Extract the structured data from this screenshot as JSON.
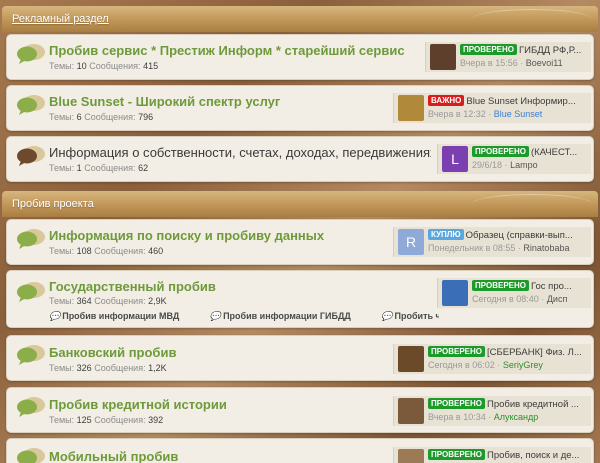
{
  "sections": [
    {
      "title": "Рекламный раздел"
    },
    {
      "title": "Пробив проекта"
    }
  ],
  "stats_labels": {
    "threads": "Темы:",
    "messages": "Сообщения:"
  },
  "nodes": [
    {
      "title": "Пробив сервис * Престиж Информ * старейший сервис ...",
      "threads": "10",
      "messages": "415",
      "last": {
        "badge": "ПРОВЕРЕНО",
        "badge_color": "#1c9b2b",
        "title": "ГИБДД РФ,Р...",
        "time": "Вчера в 15:56",
        "sep": "·",
        "user": "Boevoi11",
        "avatar_color": "#5e3f2b"
      }
    },
    {
      "title": "Blue Sunset - Широкий спектр услуг",
      "threads": "6",
      "messages": "796",
      "last": {
        "badge": "ВАЖНО",
        "badge_color": "#d81c1c",
        "title": "Blue Sunset Информир...",
        "time": "Вчера в 12:32",
        "sep": "·",
        "user": "Blue Sunset",
        "avatar_color": "#b08a3a"
      }
    },
    {
      "title": "Информация о собственности, счетах, доходах, передвижениях...",
      "threads": "1",
      "messages": "62",
      "last": {
        "badge": "ПРОВЕРЕНО",
        "badge_color": "#1c9b2b",
        "title": "(КАЧЕСТ...",
        "time": "29/6/18",
        "sep": "·",
        "user": "Lampo",
        "avatar_letter": "L",
        "avatar_color": "#7b3fb0"
      }
    },
    {
      "title": "Информация по поиску и пробиву данных",
      "threads": "108",
      "messages": "460",
      "last": {
        "badge": "КУПЛЮ",
        "badge_color": "#59a7e0",
        "title": "Образец (справки-вып...",
        "time": "Понедельник в 08:55",
        "sep": "·",
        "user": "Rinatobaba",
        "avatar_letter": "R",
        "avatar_color": "#8fa9d8"
      }
    },
    {
      "title": "Государственный пробив",
      "threads": "364",
      "messages": "2,9K",
      "sublinks": [
        "Пробив информации МВД",
        "Пробив информации ГИБДД",
        "Пробить чел"
      ],
      "last": {
        "badge": "ПРОВЕРЕНО",
        "badge_color": "#1c9b2b",
        "title": "Гос про...",
        "time": "Сегодня в 08:40",
        "sep": "·",
        "user": "Дисп",
        "avatar_color": "#3a6fb8"
      }
    },
    {
      "title": "Банковский пробив",
      "threads": "326",
      "messages": "1,2K",
      "last": {
        "badge": "ПРОВЕРЕНО",
        "badge_color": "#1c9b2b",
        "title": "[СБЕРБАНК] Физ. Л...",
        "time": "Сегодня в 06:02",
        "sep": "·",
        "user": "SeriyGrey",
        "avatar_color": "#6b4a2a"
      }
    },
    {
      "title": "Пробив кредитной истории",
      "threads": "125",
      "messages": "392",
      "last": {
        "badge": "ПРОВЕРЕНО",
        "badge_color": "#1c9b2b",
        "title": "Пробив кредитной ...",
        "time": "Вчера в 10:34",
        "sep": "·",
        "user": "Алуксандр",
        "avatar_color": "#7a5a3a"
      }
    },
    {
      "title": "Мобильный пробив",
      "threads": "",
      "messages": "",
      "last": {
        "badge": "ПРОВЕРЕНО",
        "badge_color": "#1c9b2b",
        "title": "Пробив, поиск и де...",
        "time": "",
        "sep": "",
        "user": "",
        "avatar_color": "#9b7a55"
      }
    }
  ]
}
